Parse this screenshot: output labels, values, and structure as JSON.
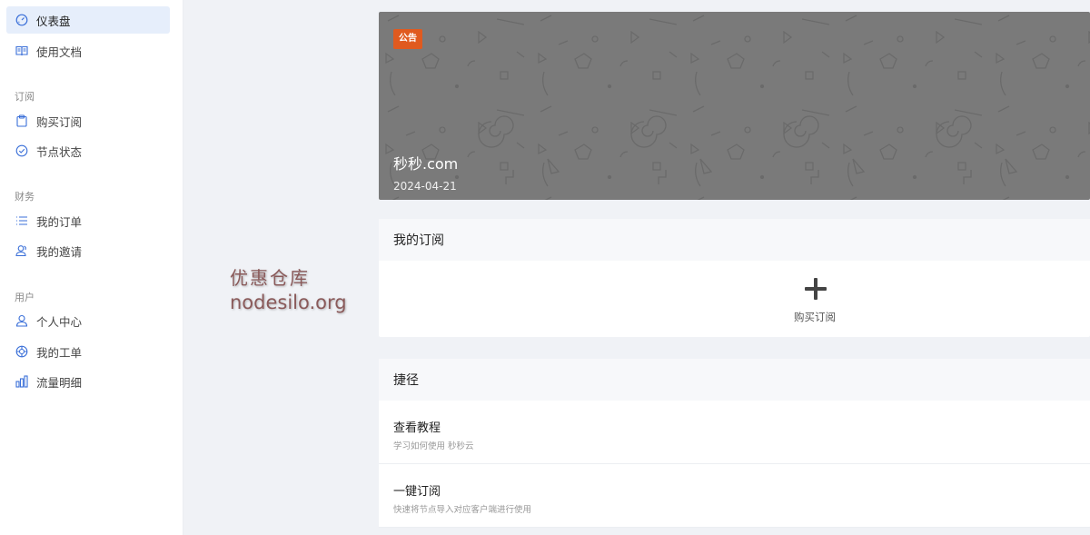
{
  "sidebar": {
    "items": [
      {
        "label": "仪表盘",
        "icon": "dashboard-icon"
      },
      {
        "label": "使用文档",
        "icon": "book-icon"
      },
      {
        "label": "购买订阅",
        "icon": "clipboard-icon"
      },
      {
        "label": "节点状态",
        "icon": "check-circle-icon"
      },
      {
        "label": "我的订单",
        "icon": "list-icon"
      },
      {
        "label": "我的邀请",
        "icon": "users-icon"
      },
      {
        "label": "个人中心",
        "icon": "user-icon"
      },
      {
        "label": "我的工单",
        "icon": "lifebuoy-icon"
      },
      {
        "label": "流量明细",
        "icon": "bar-chart-icon"
      }
    ],
    "sections": {
      "subscription": "订阅",
      "finance": "财务",
      "user": "用户"
    }
  },
  "watermark": {
    "line1": "优惠仓库",
    "line2": "nodesilo.org"
  },
  "announcement": {
    "badge": "公告",
    "title": "秒秒.com",
    "date": "2024-04-21"
  },
  "subscription": {
    "header": "我的订阅",
    "buy_label": "购买订阅"
  },
  "shortcuts": {
    "header": "捷径",
    "items": [
      {
        "title": "查看教程",
        "desc": "学习如何使用 秒秒云"
      },
      {
        "title": "一键订阅",
        "desc": "快速将节点导入对应客户端进行使用"
      }
    ]
  },
  "colors": {
    "accent_active_bg": "#e6eefb",
    "badge": "#e05a1f",
    "banner_bg": "#7a7a7a"
  }
}
